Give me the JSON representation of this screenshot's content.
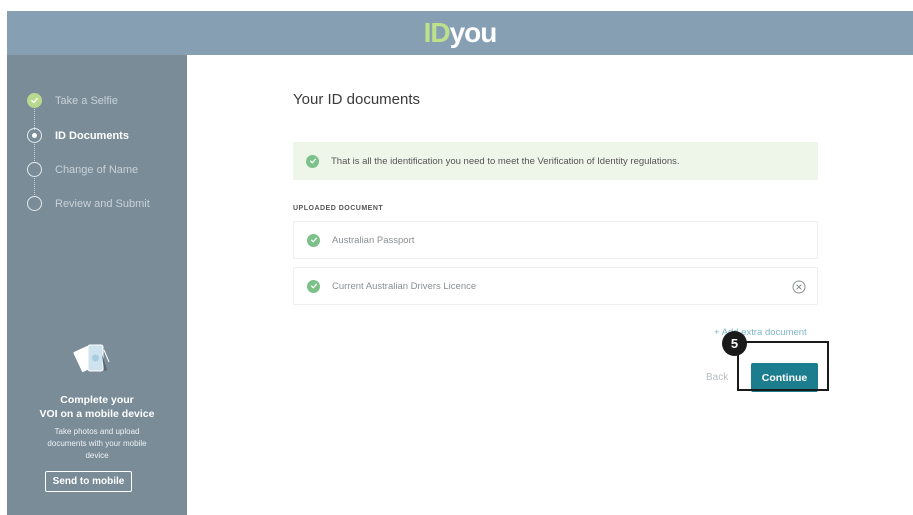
{
  "header": {
    "logo_id": "ID",
    "logo_you": "you"
  },
  "sidebar": {
    "steps": [
      {
        "label": "Take a Selfie",
        "state": "done"
      },
      {
        "label": "ID Documents",
        "state": "active"
      },
      {
        "label": "Change of Name",
        "state": "pending"
      },
      {
        "label": "Review and Submit",
        "state": "pending"
      }
    ],
    "promo": {
      "title_line1": "Complete your",
      "title_line2": "VOI on a mobile device",
      "text_line1": "Take photos and upload",
      "text_line2": "documents with your mobile",
      "text_line3": "device",
      "button_label": "Send to mobile"
    }
  },
  "main": {
    "title": "Your ID documents",
    "notice": "That is all the identification you need to meet the Verification of Identity regulations.",
    "section_label": "UPLOADED DOCUMENT",
    "documents": [
      {
        "name": "Australian Passport"
      },
      {
        "name": "Current Australian Drivers Licence"
      }
    ],
    "add_label": "+ Add extra document",
    "back_label": "Back",
    "continue_label": "Continue"
  },
  "annotation": {
    "step_number": "5"
  },
  "colors": {
    "header_bg": "#869fb3",
    "sidebar_bg": "#7a8c98",
    "accent": "#1c7d8e",
    "success": "#7cc18a",
    "logo_green": "#bde08a"
  }
}
